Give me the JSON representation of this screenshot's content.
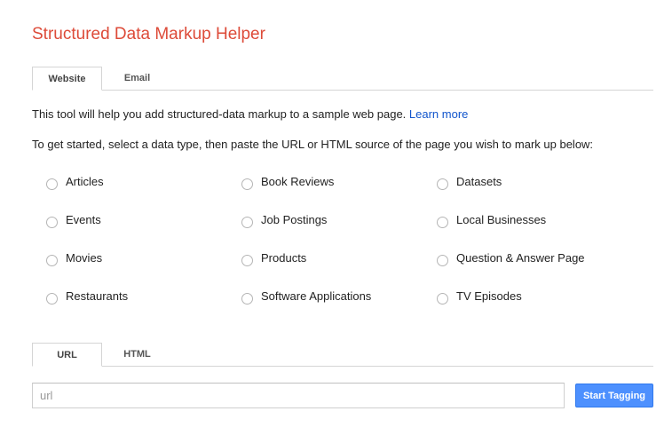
{
  "app": {
    "title": "Structured Data Markup Helper"
  },
  "source_tabs": [
    {
      "label": "Website",
      "active": true
    },
    {
      "label": "Email",
      "active": false
    }
  ],
  "intro": {
    "text": "This tool will help you add structured-data markup to a sample web page. ",
    "link_label": "Learn more"
  },
  "instructions": "To get started, select a data type, then paste the URL or HTML source of the page you wish to mark up below:",
  "data_types": [
    {
      "label": "Articles",
      "selected": false
    },
    {
      "label": "Book Reviews",
      "selected": false
    },
    {
      "label": "Datasets",
      "selected": false
    },
    {
      "label": "Events",
      "selected": false
    },
    {
      "label": "Job Postings",
      "selected": false
    },
    {
      "label": "Local Businesses",
      "selected": false
    },
    {
      "label": "Movies",
      "selected": false
    },
    {
      "label": "Products",
      "selected": false
    },
    {
      "label": "Question & Answer Page",
      "selected": false
    },
    {
      "label": "Restaurants",
      "selected": false
    },
    {
      "label": "Software Applications",
      "selected": false
    },
    {
      "label": "TV Episodes",
      "selected": false
    }
  ],
  "input_tabs": [
    {
      "label": "URL",
      "active": true
    },
    {
      "label": "HTML",
      "active": false
    }
  ],
  "url_input": {
    "value": "",
    "placeholder": "url"
  },
  "start_button": {
    "label": "Start Tagging"
  },
  "colors": {
    "title": "#dd4b39",
    "link": "#1155cc",
    "button": "#4d90fe",
    "border": "#d5d5d5"
  }
}
